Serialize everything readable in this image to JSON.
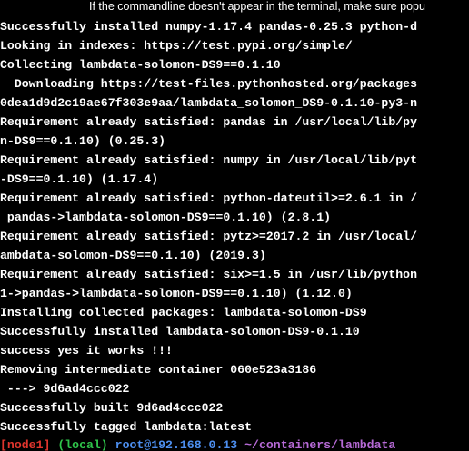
{
  "banner": {
    "text": "If the commandline doesn't appear in the terminal, make sure popu"
  },
  "terminal": {
    "lines": [
      "Successfully installed numpy-1.17.4 pandas-0.25.3 python-d",
      "Looking in indexes: https://test.pypi.org/simple/",
      "Collecting lambdata-solomon-DS9==0.1.10",
      "  Downloading https://test-files.pythonhosted.org/packages",
      "0dea1d9d2c19ae67f303e9aa/lambdata_solomon_DS9-0.1.10-py3-n",
      "Requirement already satisfied: pandas in /usr/local/lib/py",
      "n-DS9==0.1.10) (0.25.3)",
      "Requirement already satisfied: numpy in /usr/local/lib/pyt",
      "-DS9==0.1.10) (1.17.4)",
      "Requirement already satisfied: python-dateutil>=2.6.1 in /",
      " pandas->lambdata-solomon-DS9==0.1.10) (2.8.1)",
      "Requirement already satisfied: pytz>=2017.2 in /usr/local/",
      "ambdata-solomon-DS9==0.1.10) (2019.3)",
      "Requirement already satisfied: six>=1.5 in /usr/lib/python",
      "1->pandas->lambdata-solomon-DS9==0.1.10) (1.12.0)",
      "Installing collected packages: lambdata-solomon-DS9",
      "Successfully installed lambdata-solomon-DS9-0.1.10",
      "success yes it works !!!",
      "Removing intermediate container 060e523a3186",
      " ---> 9d6ad4ccc022",
      "Successfully built 9d6ad4ccc022",
      "Successfully tagged lambdata:latest"
    ],
    "prompt": {
      "node": "[node1]",
      "env": "(local)",
      "user_host": "root@192.168.0.13",
      "path": "~/containers/lambdata"
    }
  },
  "colors": {
    "background": "#000000",
    "text": "#ffffff",
    "node": "#e0352d",
    "env": "#2fc44a",
    "user_host": "#4d8ff0",
    "path": "#b66ad6"
  }
}
